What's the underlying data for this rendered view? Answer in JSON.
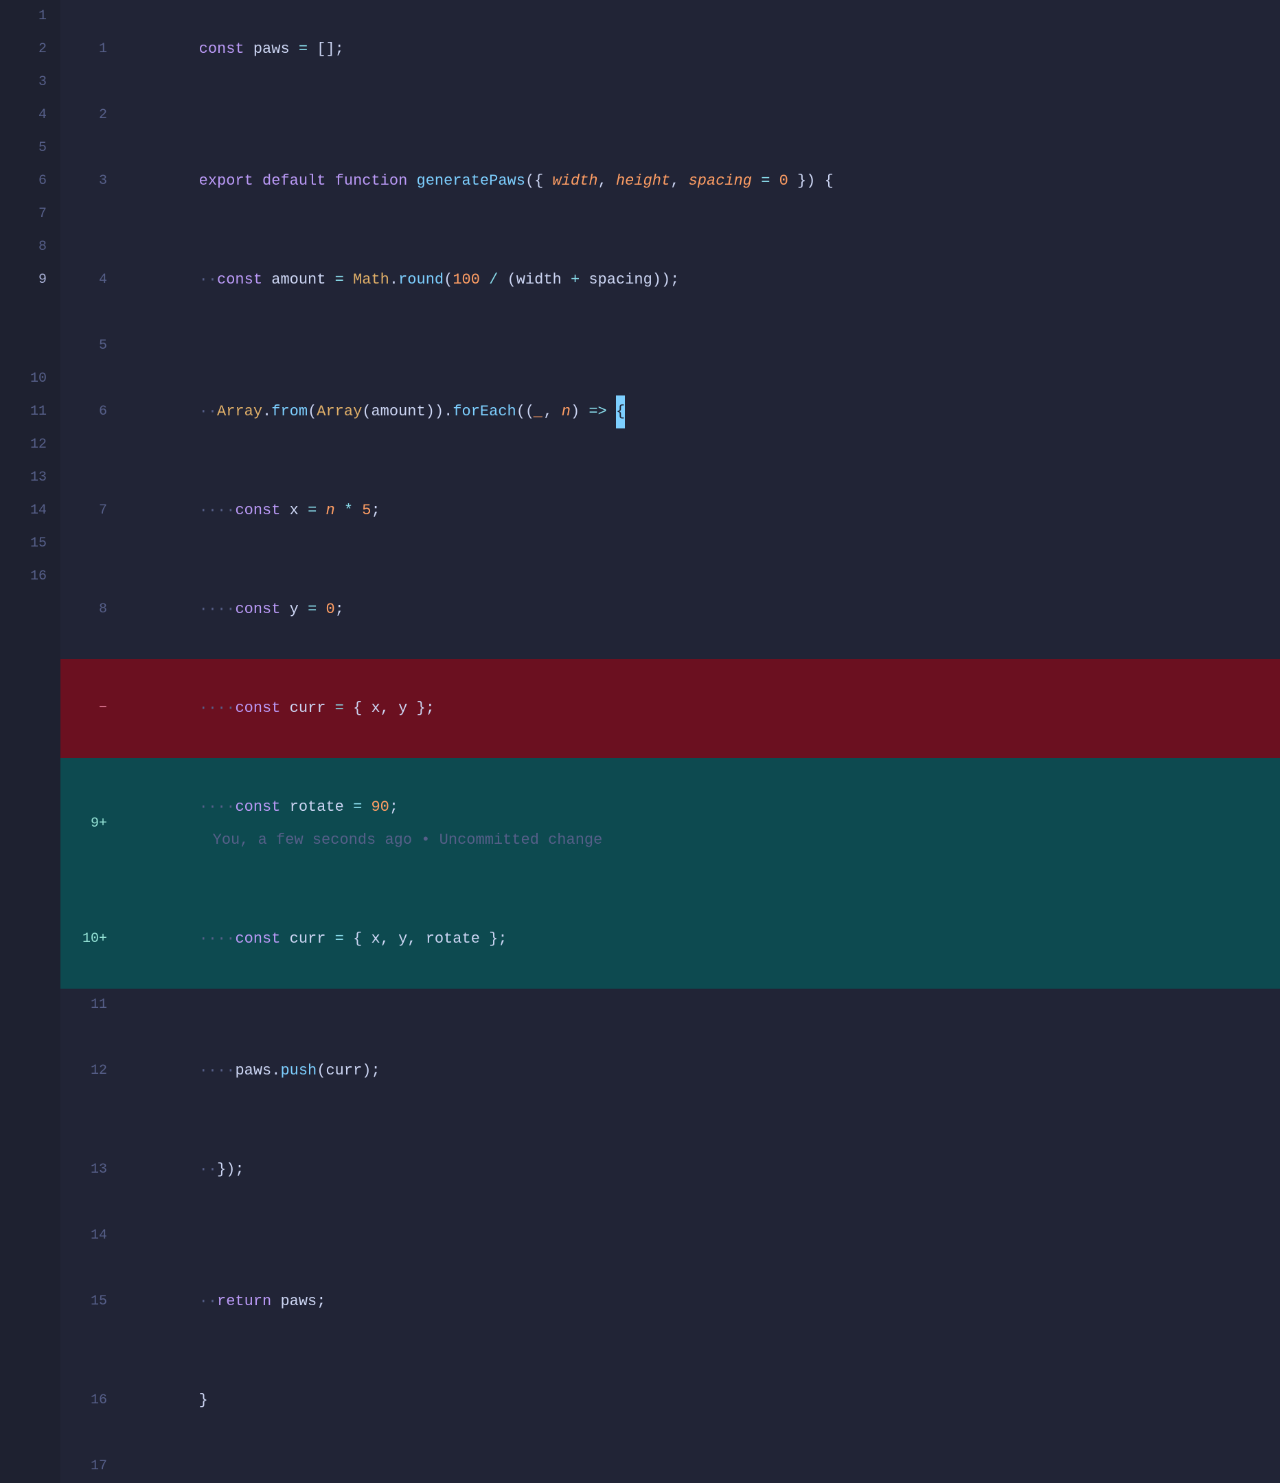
{
  "editor": {
    "background": "#1e2130",
    "gutter_bg": "#212436",
    "lines": [
      {
        "left_num": "1",
        "right_num": "1",
        "type": "normal",
        "content": "const_paws_init"
      },
      {
        "left_num": "2",
        "right_num": "2",
        "type": "empty"
      },
      {
        "left_num": "3",
        "right_num": "3",
        "type": "normal",
        "content": "export_default_function"
      },
      {
        "left_num": "4",
        "right_num": "4",
        "type": "normal",
        "content": "const_amount"
      },
      {
        "left_num": "5",
        "right_num": "5",
        "type": "empty"
      },
      {
        "left_num": "6",
        "right_num": "6",
        "type": "normal",
        "content": "array_from"
      },
      {
        "left_num": "7",
        "right_num": "7",
        "type": "normal",
        "content": "const_x"
      },
      {
        "left_num": "8",
        "right_num": "8",
        "type": "normal",
        "content": "const_y"
      },
      {
        "left_num": "9",
        "right_num": null,
        "type": "removed",
        "content": "const_curr_old"
      },
      {
        "left_num": null,
        "right_num": "9+",
        "type": "added",
        "content": "const_rotate"
      },
      {
        "left_num": null,
        "right_num": "10+",
        "type": "added",
        "content": "const_curr_new"
      },
      {
        "left_num": "10",
        "right_num": "11",
        "type": "empty"
      },
      {
        "left_num": "11",
        "right_num": "12",
        "type": "normal",
        "content": "paws_push"
      },
      {
        "left_num": "12",
        "right_num": "13",
        "type": "normal",
        "content": "close_brace"
      },
      {
        "left_num": "13",
        "right_num": "14",
        "type": "empty"
      },
      {
        "left_num": "14",
        "right_num": "15",
        "type": "normal",
        "content": "return_paws"
      },
      {
        "left_num": "15",
        "right_num": "16",
        "type": "normal",
        "content": "fn_close"
      },
      {
        "left_num": "16",
        "right_num": "17",
        "type": "empty"
      }
    ],
    "blame_text": "You, a few seconds ago • Uncommitted change",
    "removed_marker": "−",
    "added_marker": "+"
  }
}
